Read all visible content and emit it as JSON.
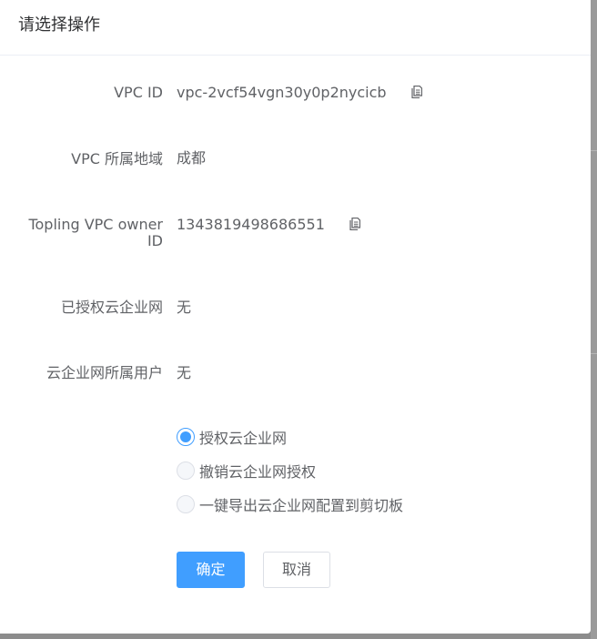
{
  "dialog": {
    "title": "请选择操作"
  },
  "fields": [
    {
      "label": "VPC ID",
      "value": "vpc-2vcf54vgn30y0p2nycicb",
      "copyable": true
    },
    {
      "label": "VPC 所属地域",
      "value": "成都",
      "copyable": false
    },
    {
      "label_line1": "Topling VPC owner",
      "label_line2": "ID",
      "value": "1343819498686551",
      "copyable": true
    },
    {
      "label": "已授权云企业网",
      "value": "无",
      "copyable": false
    },
    {
      "label": "云企业网所属用户",
      "value": "无",
      "copyable": false
    }
  ],
  "radios": [
    {
      "label": "授权云企业网",
      "checked": true
    },
    {
      "label": "撤销云企业网授权",
      "checked": false
    },
    {
      "label": "一键导出云企业网配置到剪切板",
      "checked": false
    }
  ],
  "buttons": {
    "confirm": "确定",
    "cancel": "取消"
  },
  "icons": {
    "copy": "copy-icon"
  },
  "colors": {
    "primary": "#409eff",
    "text": "#606266",
    "title": "#303133"
  }
}
